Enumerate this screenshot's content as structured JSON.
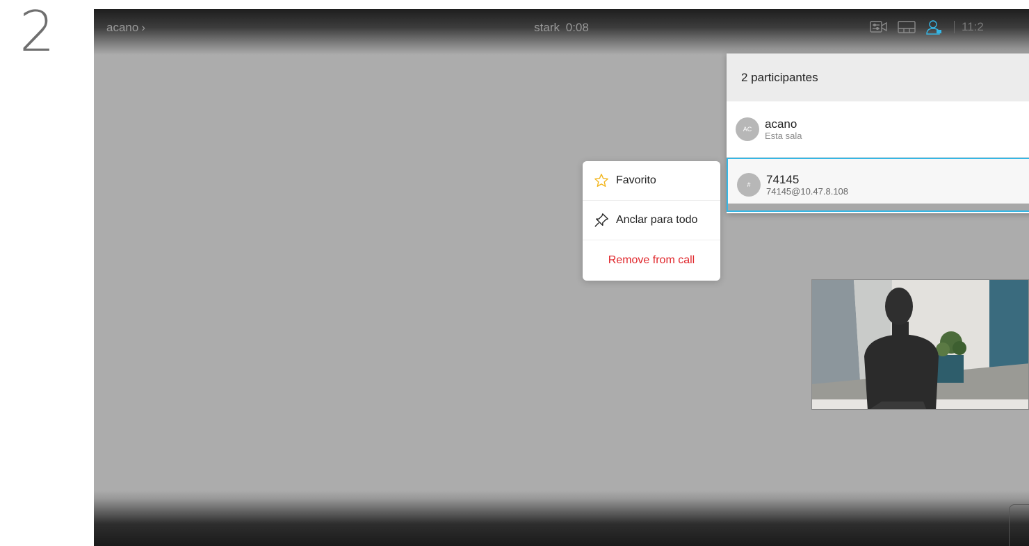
{
  "step_number": "2",
  "topbar": {
    "breadcrumb": "acano",
    "breadcrumb_chevron": "›",
    "call_name": "stark",
    "call_duration": "0:08",
    "icons": [
      "camera-control-icon",
      "layout-icon",
      "participants-icon"
    ],
    "clock": "11:2"
  },
  "participants_panel": {
    "header": "2 participantes",
    "participants": [
      {
        "initials": "AC",
        "name": "acano",
        "subtitle": "Esta sala"
      },
      {
        "initials": "#",
        "name": "74145",
        "subtitle": "74145@10.47.8.108"
      }
    ]
  },
  "context_menu": {
    "favorite_label": "Favorito",
    "pin_label": "Anclar para todo",
    "remove_label": "Remove from call",
    "remove_color": "#e0262b",
    "favorite_icon_color": "#f2b51c"
  },
  "selection_color": "#35b7e6"
}
